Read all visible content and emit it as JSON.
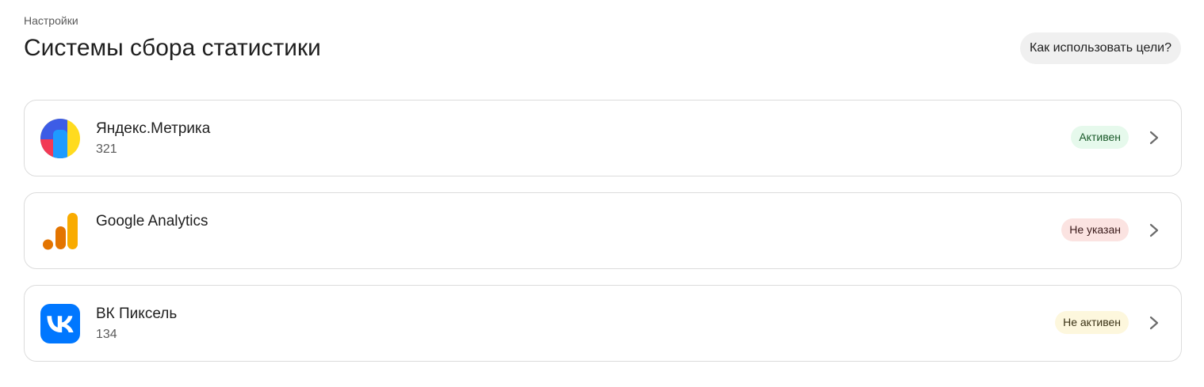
{
  "breadcrumb": "Настройки",
  "title": "Системы сбора статистики",
  "help_button": "Как использовать цели?",
  "systems": [
    {
      "name": "Яндекс.Метрика",
      "count": "321",
      "status": "Активен",
      "status_color": "#e6f9ec",
      "icon": "yandex-metrika-logo"
    },
    {
      "name": "Google Analytics",
      "count": "",
      "status": "Не указан",
      "status_color": "#fbe3e1",
      "icon": "google-analytics-logo"
    },
    {
      "name": "ВК Пиксель",
      "count": "134",
      "status": "Не активен",
      "status_color": "#fdf7dd",
      "icon": "vk-logo"
    }
  ]
}
